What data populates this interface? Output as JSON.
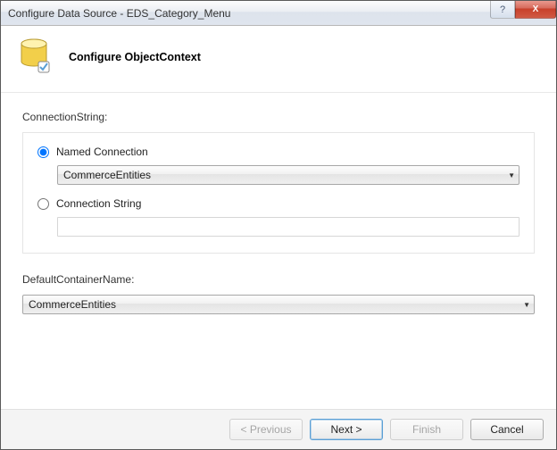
{
  "window": {
    "title": "Configure Data Source - EDS_Category_Menu"
  },
  "header": {
    "title": "Configure ObjectContext"
  },
  "connection": {
    "group_label": "ConnectionString:",
    "named_label": "Named Connection",
    "named_selected_value": "CommerceEntities",
    "string_label": "Connection String",
    "string_value": ""
  },
  "container": {
    "group_label": "DefaultContainerName:",
    "selected_value": "CommerceEntities"
  },
  "buttons": {
    "previous": "< Previous",
    "next": "Next >",
    "finish": "Finish",
    "cancel": "Cancel",
    "help": "?",
    "close": "X"
  }
}
